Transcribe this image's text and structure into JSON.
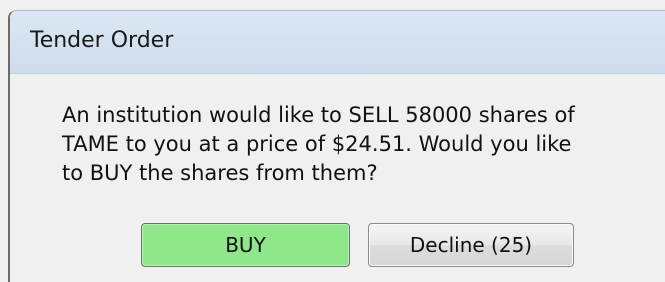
{
  "dialog": {
    "title": "Tender Order",
    "message_lines": [
      "An institution would like to SELL 58000 shares of",
      "TAME to you at a price of $24.51.  Would you like",
      "to BUY the shares from them?"
    ],
    "buttons": {
      "buy_label": "BUY",
      "decline_label": "Decline (25)"
    }
  },
  "colors": {
    "titlebar": "#d6e3f0",
    "body": "#f0f0f0",
    "buy_button": "#8fe68b",
    "decline_button": "#e3e3e3"
  }
}
